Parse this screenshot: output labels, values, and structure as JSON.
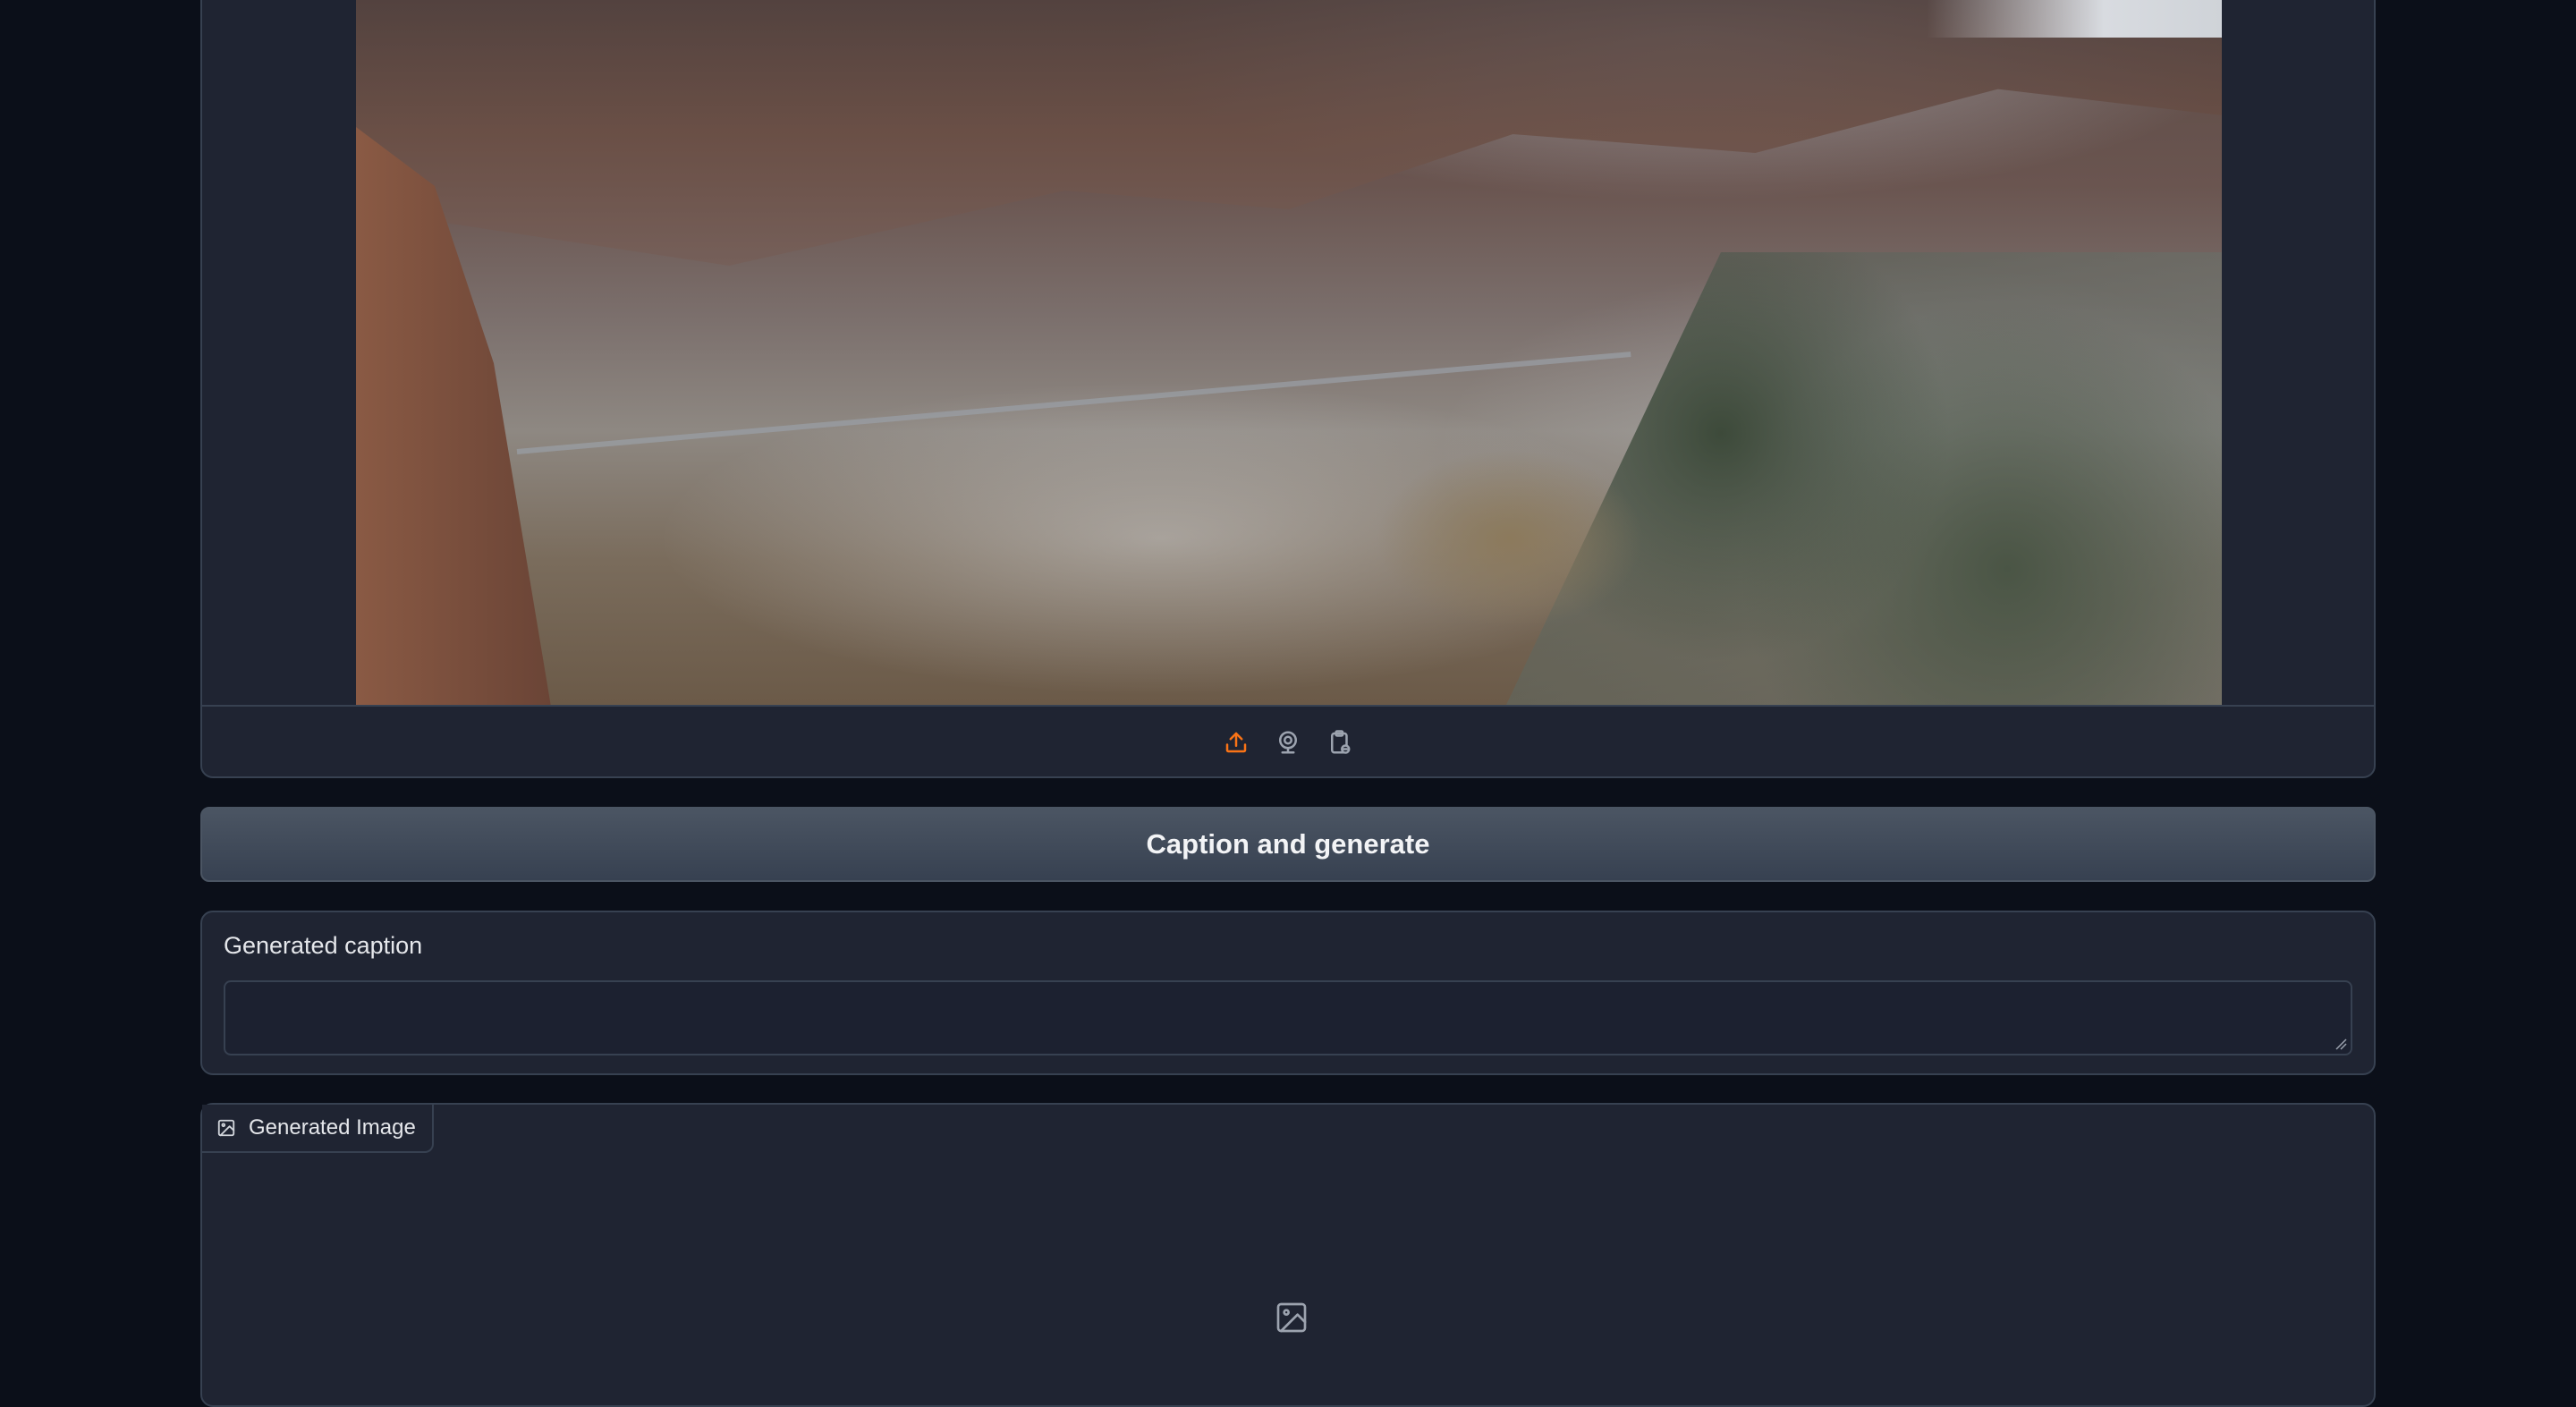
{
  "input": {
    "image_alt": "Snowy canyon valley landscape",
    "sources": [
      {
        "name": "upload-icon",
        "color": "#f97316"
      },
      {
        "name": "webcam-icon",
        "color": "#9ca3af"
      },
      {
        "name": "clipboard-icon",
        "color": "#9ca3af"
      }
    ]
  },
  "actions": {
    "caption_button": "Caption and generate"
  },
  "caption": {
    "label": "Generated caption",
    "value": ""
  },
  "output": {
    "label": "Generated Image"
  }
}
